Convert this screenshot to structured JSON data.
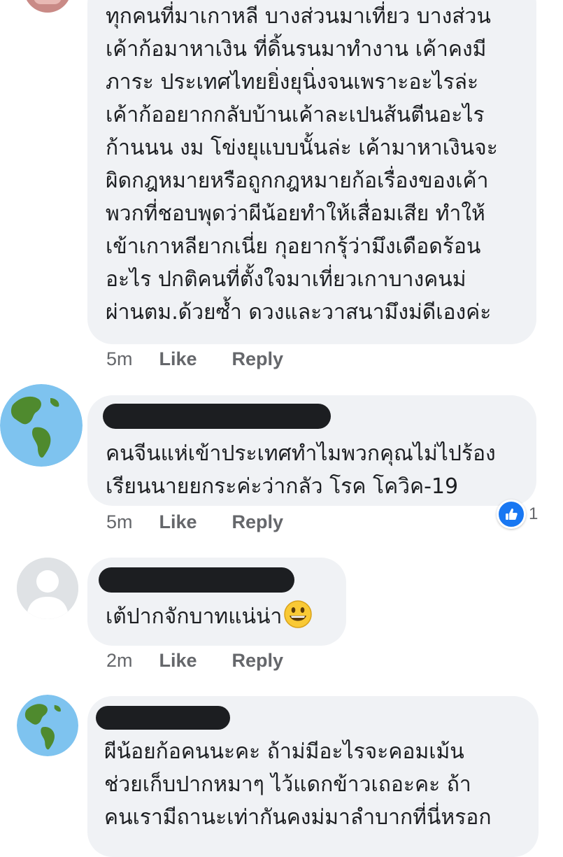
{
  "colors": {
    "bubble_bg": "#f0f2f5",
    "meta_text": "#65676b",
    "like_blue": "#1877f2",
    "redaction": "#1c1e21"
  },
  "comments": [
    {
      "text": "ทุกคนที่มาเกาหลี บางส่วนมาเที่ยว บางส่วน\nเค้าก้อมาหาเงิน ที่ดิ้นรนมาทำงาน เค้าคงมี\nภาระ ประเทศไทยยิ่งยุนิ่งจนเพราะอะไรล่ะ\nเค้าก้ออยากกลับบ้านเค้าละเปนส้นตีนอะไร\nก้านนน งม โข่งยุแบบนั้นล่ะ เค้ามาหาเงินจะ\nผิดกฎหมายหรือถูกกฎหมายก้อเรื่องของเค้า\nพวกที่ชอบพุดว่าผีน้อยทำให้เสื่อมเสีย ทำให้\nเข้าเกาหลียากเนี่ย กุอยากรุ้ว่ามึงเดือดร้อน\nอะไร ปกติคนที่ตั้งใจมาเที่ยวเกาบางคนม่\nผ่านตม.ด้วยซ้ำ ดวงและวาสนามึงม่ดีเองค่ะ",
      "time": "5m",
      "like_label": "Like",
      "reply_label": "Reply"
    },
    {
      "avatar_icon": "earth-globe-icon",
      "text": "คนจีนแห่เข้าประเทศทำไมพวกคุณไม่ไปร้อง\nเรียนนายยกระค่ะว่ากลัว โรค โควิค-19",
      "time": "5m",
      "like_label": "Like",
      "reply_label": "Reply",
      "reaction_count": "1",
      "reaction_icon": "thumbs-up-icon"
    },
    {
      "avatar_icon": "default-profile-icon",
      "text": "เต้ปากจักบาทแน่น่า",
      "emoji": "grinning-face-icon",
      "time": "2m",
      "like_label": "Like",
      "reply_label": "Reply"
    },
    {
      "avatar_icon": "earth-globe-icon",
      "text": "ผีน้อยก้อคนนะคะ  ถ้าม่มีอะไรจะคอมเม้น\nช่วยเก็บปากหมาๆ ไว้แดกข้าวเถอะคะ  ถ้า\nคนเรามีถานะเท่ากันคงม่มาลำบากที่นี่หรอก"
    }
  ]
}
